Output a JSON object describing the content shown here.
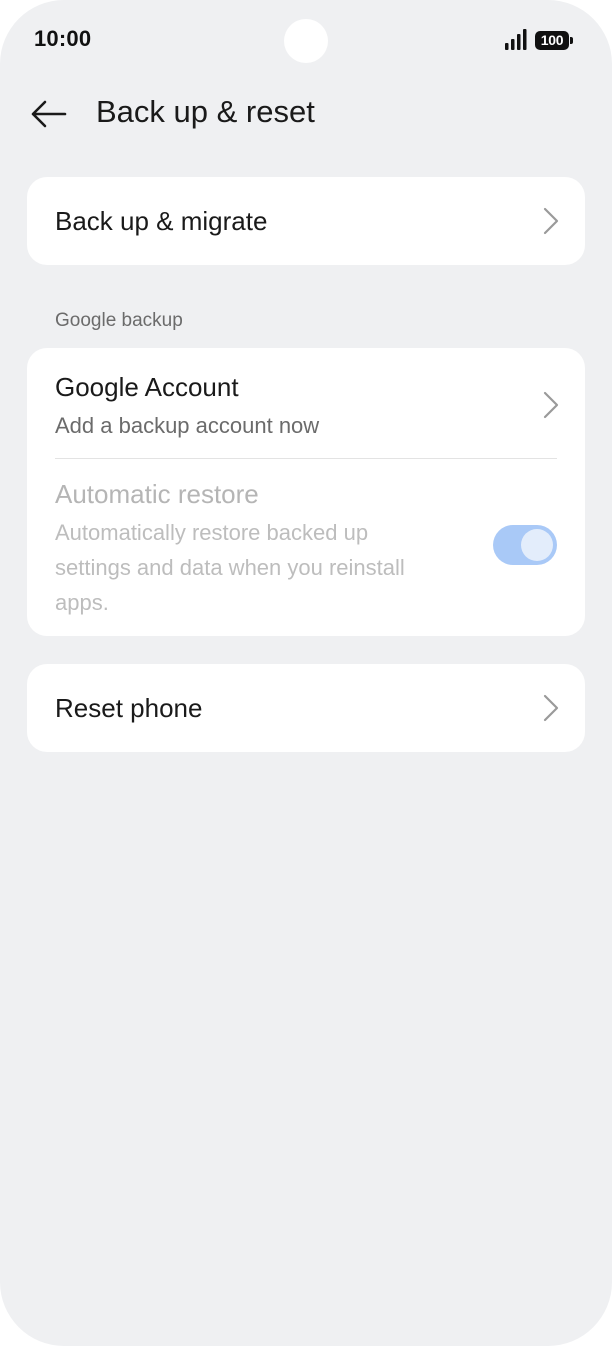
{
  "status_bar": {
    "time": "10:00",
    "battery": "100",
    "icons": [
      "signal-icon",
      "battery-icon"
    ]
  },
  "header": {
    "back_icon": "arrow-left-icon",
    "title": "Back up & reset"
  },
  "backup_migrate": {
    "title": "Back up & migrate",
    "icon": "chevron-right-icon"
  },
  "google_backup": {
    "section_label": "Google backup",
    "account": {
      "title": "Google Account",
      "subtitle": "Add a backup account now",
      "icon": "chevron-right-icon"
    },
    "auto_restore": {
      "title": "Automatic restore",
      "subtitle_lines": [
        "Automatically restore backed up",
        "settings and data when you reinstall",
        "apps."
      ],
      "enabled": true,
      "disabled_state": true,
      "toggle_color": "#a9c9f7"
    }
  },
  "reset_phone": {
    "title": "Reset phone",
    "icon": "chevron-right-icon"
  },
  "colors": {
    "background": "#eff0f2",
    "card": "#ffffff",
    "text_primary": "#1a1a1a",
    "text_secondary": "#6b6b6b",
    "text_disabled": "#b5b5b5"
  }
}
